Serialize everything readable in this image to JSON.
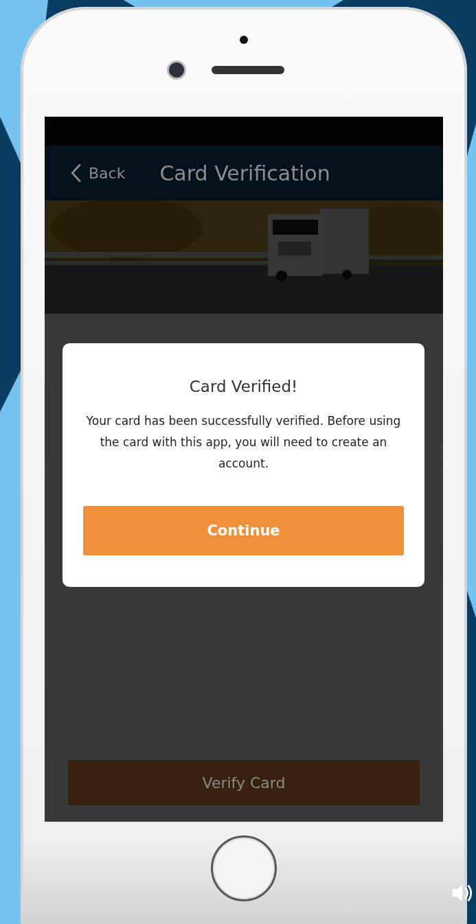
{
  "nav": {
    "back": "Back",
    "title": "Card Verification"
  },
  "primary_button": {
    "label": "Verify Card"
  },
  "modal": {
    "title": "Card Verified!",
    "message": "Your card has been successfully verified. Before using the card with this app, you will need to create an account.",
    "button": "Continue"
  }
}
